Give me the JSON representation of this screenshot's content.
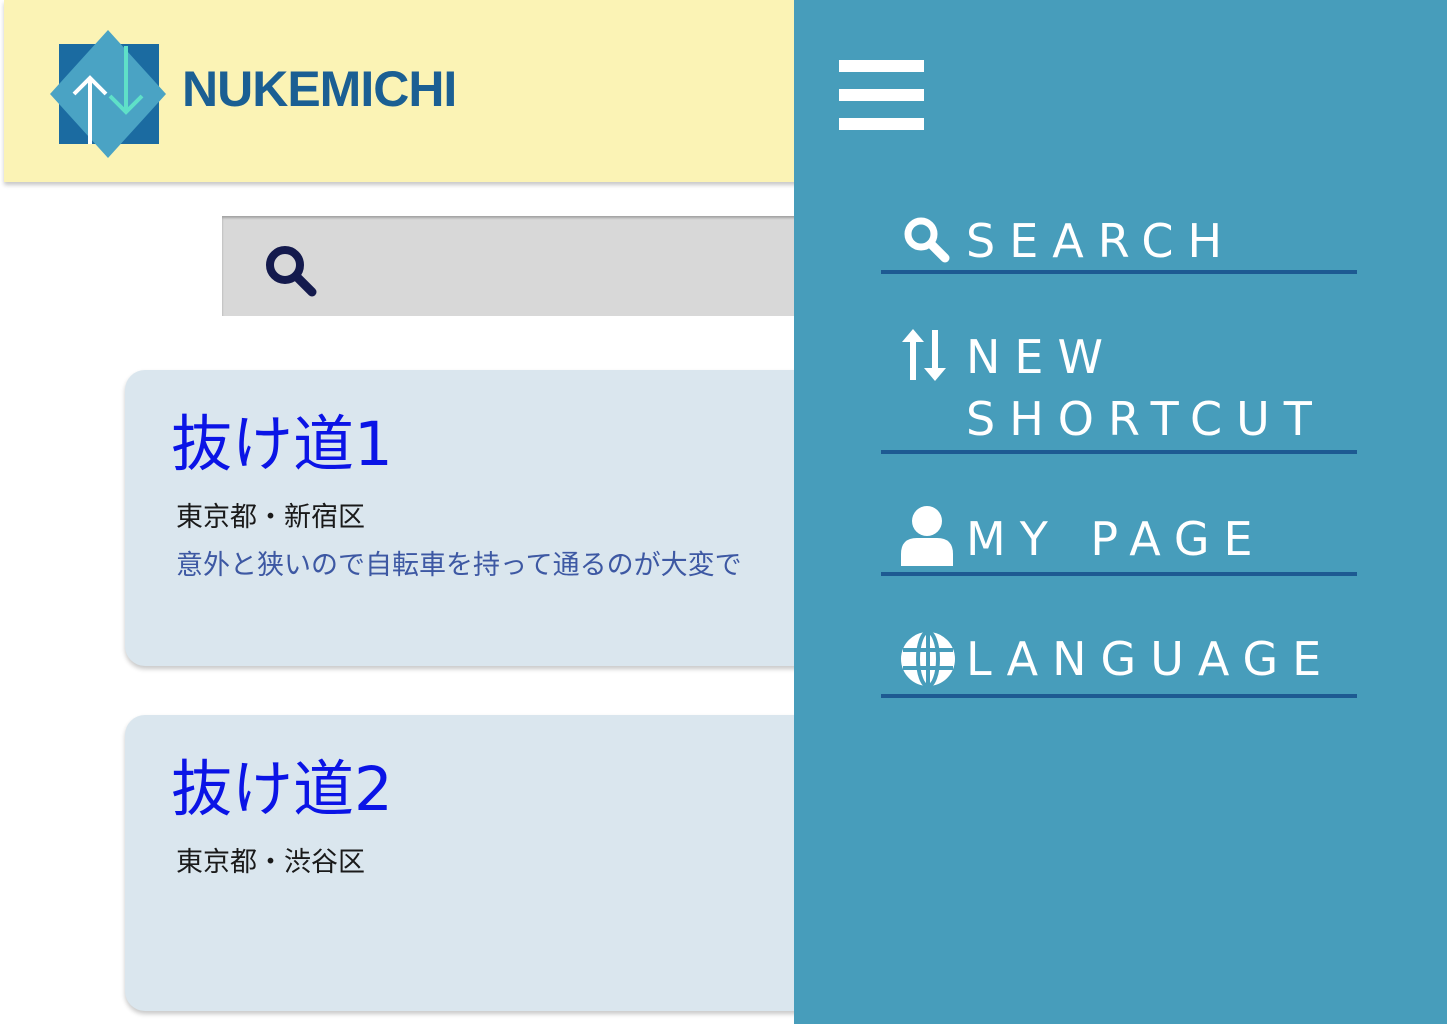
{
  "header": {
    "app_name": "NUKEMICHI",
    "logo_icon": "up-down-arrows-diamond-logo"
  },
  "search": {
    "icon": "search-icon",
    "value": ""
  },
  "cards": [
    {
      "title": "抜け道1",
      "location": "東京都・新宿区",
      "description": "意外と狭いので自転車を持って通るのが大変で"
    },
    {
      "title": "抜け道2",
      "location": "東京都・渋谷区",
      "description": ""
    }
  ],
  "drawer": {
    "menu_icon": "hamburger-icon",
    "items": [
      {
        "label": "SEARCH",
        "icon": "search-icon"
      },
      {
        "label_line1": "NEW",
        "label_line2": "SHORTCUT",
        "icon": "up-down-arrows-icon"
      },
      {
        "label": "MY PAGE",
        "icon": "user-icon"
      },
      {
        "label": "LANGUAGE",
        "icon": "globe-icon"
      }
    ]
  },
  "colors": {
    "header_bg": "#fbf3b5",
    "brand": "#1b5f93",
    "drawer_bg": "#479dbb",
    "divider": "#1d5a92",
    "card_bg": "#dae6ee",
    "card_title": "#0b14e6",
    "card_desc": "#3d58a3"
  }
}
